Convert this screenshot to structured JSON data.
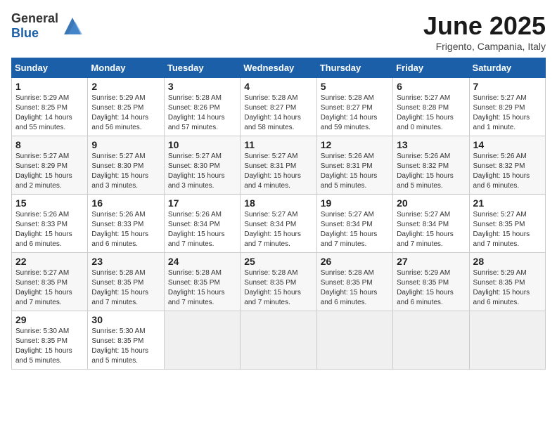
{
  "header": {
    "logo_general": "General",
    "logo_blue": "Blue",
    "month": "June 2025",
    "location": "Frigento, Campania, Italy"
  },
  "days_of_week": [
    "Sunday",
    "Monday",
    "Tuesday",
    "Wednesday",
    "Thursday",
    "Friday",
    "Saturday"
  ],
  "weeks": [
    [
      {
        "day": "1",
        "info": "Sunrise: 5:29 AM\nSunset: 8:25 PM\nDaylight: 14 hours\nand 55 minutes."
      },
      {
        "day": "2",
        "info": "Sunrise: 5:29 AM\nSunset: 8:25 PM\nDaylight: 14 hours\nand 56 minutes."
      },
      {
        "day": "3",
        "info": "Sunrise: 5:28 AM\nSunset: 8:26 PM\nDaylight: 14 hours\nand 57 minutes."
      },
      {
        "day": "4",
        "info": "Sunrise: 5:28 AM\nSunset: 8:27 PM\nDaylight: 14 hours\nand 58 minutes."
      },
      {
        "day": "5",
        "info": "Sunrise: 5:28 AM\nSunset: 8:27 PM\nDaylight: 14 hours\nand 59 minutes."
      },
      {
        "day": "6",
        "info": "Sunrise: 5:27 AM\nSunset: 8:28 PM\nDaylight: 15 hours\nand 0 minutes."
      },
      {
        "day": "7",
        "info": "Sunrise: 5:27 AM\nSunset: 8:29 PM\nDaylight: 15 hours\nand 1 minute."
      }
    ],
    [
      {
        "day": "8",
        "info": "Sunrise: 5:27 AM\nSunset: 8:29 PM\nDaylight: 15 hours\nand 2 minutes."
      },
      {
        "day": "9",
        "info": "Sunrise: 5:27 AM\nSunset: 8:30 PM\nDaylight: 15 hours\nand 3 minutes."
      },
      {
        "day": "10",
        "info": "Sunrise: 5:27 AM\nSunset: 8:30 PM\nDaylight: 15 hours\nand 3 minutes."
      },
      {
        "day": "11",
        "info": "Sunrise: 5:27 AM\nSunset: 8:31 PM\nDaylight: 15 hours\nand 4 minutes."
      },
      {
        "day": "12",
        "info": "Sunrise: 5:26 AM\nSunset: 8:31 PM\nDaylight: 15 hours\nand 5 minutes."
      },
      {
        "day": "13",
        "info": "Sunrise: 5:26 AM\nSunset: 8:32 PM\nDaylight: 15 hours\nand 5 minutes."
      },
      {
        "day": "14",
        "info": "Sunrise: 5:26 AM\nSunset: 8:32 PM\nDaylight: 15 hours\nand 6 minutes."
      }
    ],
    [
      {
        "day": "15",
        "info": "Sunrise: 5:26 AM\nSunset: 8:33 PM\nDaylight: 15 hours\nand 6 minutes."
      },
      {
        "day": "16",
        "info": "Sunrise: 5:26 AM\nSunset: 8:33 PM\nDaylight: 15 hours\nand 6 minutes."
      },
      {
        "day": "17",
        "info": "Sunrise: 5:26 AM\nSunset: 8:34 PM\nDaylight: 15 hours\nand 7 minutes."
      },
      {
        "day": "18",
        "info": "Sunrise: 5:27 AM\nSunset: 8:34 PM\nDaylight: 15 hours\nand 7 minutes."
      },
      {
        "day": "19",
        "info": "Sunrise: 5:27 AM\nSunset: 8:34 PM\nDaylight: 15 hours\nand 7 minutes."
      },
      {
        "day": "20",
        "info": "Sunrise: 5:27 AM\nSunset: 8:34 PM\nDaylight: 15 hours\nand 7 minutes."
      },
      {
        "day": "21",
        "info": "Sunrise: 5:27 AM\nSunset: 8:35 PM\nDaylight: 15 hours\nand 7 minutes."
      }
    ],
    [
      {
        "day": "22",
        "info": "Sunrise: 5:27 AM\nSunset: 8:35 PM\nDaylight: 15 hours\nand 7 minutes."
      },
      {
        "day": "23",
        "info": "Sunrise: 5:28 AM\nSunset: 8:35 PM\nDaylight: 15 hours\nand 7 minutes."
      },
      {
        "day": "24",
        "info": "Sunrise: 5:28 AM\nSunset: 8:35 PM\nDaylight: 15 hours\nand 7 minutes."
      },
      {
        "day": "25",
        "info": "Sunrise: 5:28 AM\nSunset: 8:35 PM\nDaylight: 15 hours\nand 7 minutes."
      },
      {
        "day": "26",
        "info": "Sunrise: 5:28 AM\nSunset: 8:35 PM\nDaylight: 15 hours\nand 6 minutes."
      },
      {
        "day": "27",
        "info": "Sunrise: 5:29 AM\nSunset: 8:35 PM\nDaylight: 15 hours\nand 6 minutes."
      },
      {
        "day": "28",
        "info": "Sunrise: 5:29 AM\nSunset: 8:35 PM\nDaylight: 15 hours\nand 6 minutes."
      }
    ],
    [
      {
        "day": "29",
        "info": "Sunrise: 5:30 AM\nSunset: 8:35 PM\nDaylight: 15 hours\nand 5 minutes."
      },
      {
        "day": "30",
        "info": "Sunrise: 5:30 AM\nSunset: 8:35 PM\nDaylight: 15 hours\nand 5 minutes."
      },
      {
        "day": "",
        "info": ""
      },
      {
        "day": "",
        "info": ""
      },
      {
        "day": "",
        "info": ""
      },
      {
        "day": "",
        "info": ""
      },
      {
        "day": "",
        "info": ""
      }
    ]
  ]
}
